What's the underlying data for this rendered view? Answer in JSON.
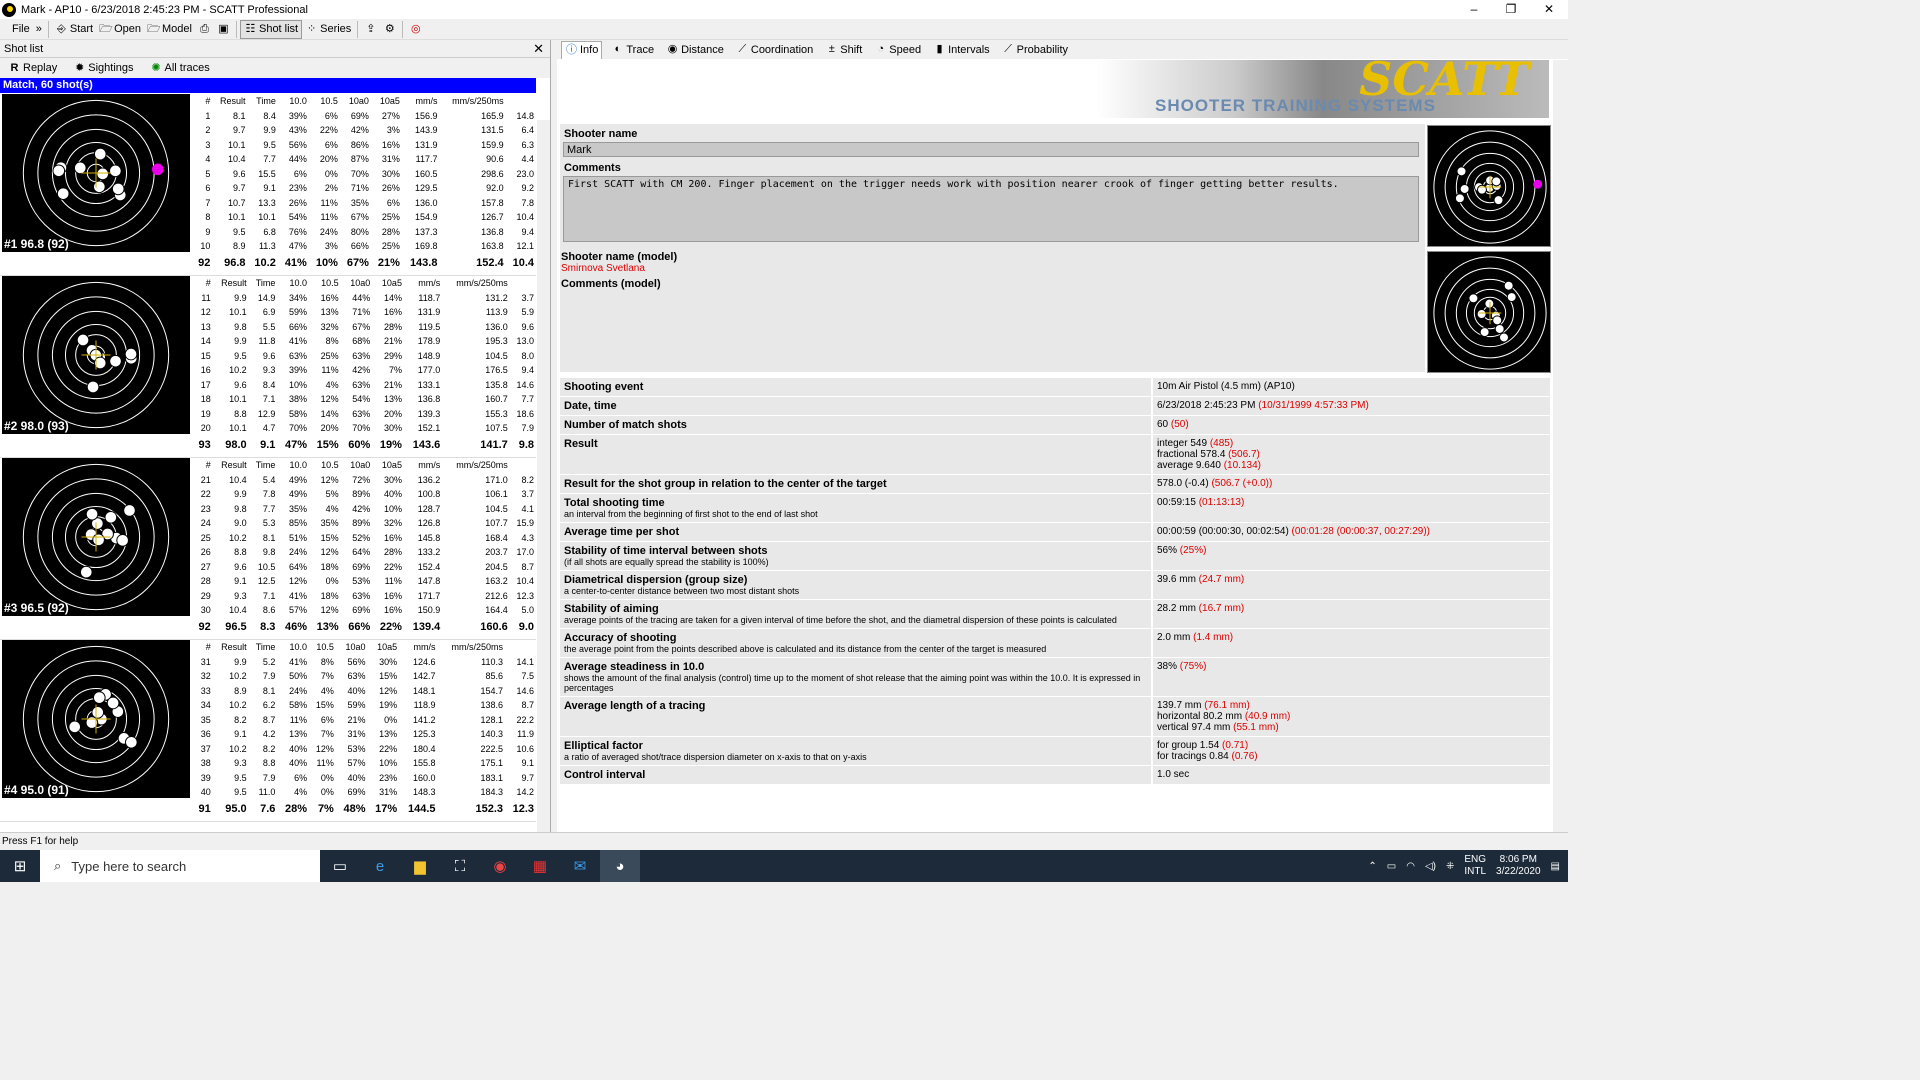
{
  "window": {
    "title": "Mark - AP10 - 6/23/2018 2:45:23 PM - SCATT Professional",
    "minimize": "–",
    "maximize": "❐",
    "close": "✕"
  },
  "menu": {
    "file": "File",
    "more": "»",
    "start": "Start",
    "open": "Open",
    "model": "Model",
    "shotlist": "Shot list",
    "series": "Series"
  },
  "left": {
    "header": "Shot list",
    "close": "✕",
    "replay": "Replay",
    "sightings": "Sightings",
    "alltraces": "All traces",
    "match": "Match, 60 shot(s)",
    "columns": [
      "#",
      "Result",
      "Time",
      "10.0",
      "10.5",
      "10a0",
      "10a5",
      "mm/s",
      "mm/s/250ms",
      ""
    ],
    "series": [
      {
        "label": "#1 96.8 (92)",
        "rows": [
          [
            "1",
            "8.1",
            "8.4",
            "39%",
            "6%",
            "69%",
            "27%",
            "156.9",
            "165.9",
            "14.8"
          ],
          [
            "2",
            "9.7",
            "9.9",
            "43%",
            "22%",
            "42%",
            "3%",
            "143.9",
            "131.5",
            "6.4"
          ],
          [
            "3",
            "10.1",
            "9.5",
            "56%",
            "6%",
            "86%",
            "16%",
            "131.9",
            "159.9",
            "6.3"
          ],
          [
            "4",
            "10.4",
            "7.7",
            "44%",
            "20%",
            "87%",
            "31%",
            "117.7",
            "90.6",
            "4.4"
          ],
          [
            "5",
            "9.6",
            "15.5",
            "6%",
            "0%",
            "70%",
            "30%",
            "160.5",
            "298.6",
            "23.0"
          ],
          [
            "6",
            "9.7",
            "9.1",
            "23%",
            "2%",
            "71%",
            "26%",
            "129.5",
            "92.0",
            "9.2"
          ],
          [
            "7",
            "10.7",
            "13.3",
            "26%",
            "11%",
            "35%",
            "6%",
            "136.0",
            "157.8",
            "7.8"
          ],
          [
            "8",
            "10.1",
            "10.1",
            "54%",
            "11%",
            "67%",
            "25%",
            "154.9",
            "126.7",
            "10.4"
          ],
          [
            "9",
            "9.5",
            "6.8",
            "76%",
            "24%",
            "80%",
            "28%",
            "137.3",
            "136.8",
            "9.4"
          ],
          [
            "10",
            "8.9",
            "11.3",
            "47%",
            "3%",
            "66%",
            "25%",
            "169.8",
            "163.8",
            "12.1"
          ]
        ],
        "sum": [
          "92",
          "96.8",
          "10.2",
          "41%",
          "10%",
          "67%",
          "21%",
          "143.8",
          "152.4",
          "10.4"
        ]
      },
      {
        "label": "#2 98.0 (93)",
        "rows": [
          [
            "11",
            "9.9",
            "14.9",
            "34%",
            "16%",
            "44%",
            "14%",
            "118.7",
            "131.2",
            "3.7"
          ],
          [
            "12",
            "10.1",
            "6.9",
            "59%",
            "13%",
            "71%",
            "16%",
            "131.9",
            "113.9",
            "5.9"
          ],
          [
            "13",
            "9.8",
            "5.5",
            "66%",
            "32%",
            "67%",
            "28%",
            "119.5",
            "136.0",
            "9.6"
          ],
          [
            "14",
            "9.9",
            "11.8",
            "41%",
            "8%",
            "68%",
            "21%",
            "178.9",
            "195.3",
            "13.0"
          ],
          [
            "15",
            "9.5",
            "9.6",
            "63%",
            "25%",
            "63%",
            "29%",
            "148.9",
            "104.5",
            "8.0"
          ],
          [
            "16",
            "10.2",
            "9.3",
            "39%",
            "11%",
            "42%",
            "7%",
            "177.0",
            "176.5",
            "9.4"
          ],
          [
            "17",
            "9.6",
            "8.4",
            "10%",
            "4%",
            "63%",
            "21%",
            "133.1",
            "135.8",
            "14.6"
          ],
          [
            "18",
            "10.1",
            "7.1",
            "38%",
            "12%",
            "54%",
            "13%",
            "136.8",
            "160.7",
            "7.7"
          ],
          [
            "19",
            "8.8",
            "12.9",
            "58%",
            "14%",
            "63%",
            "20%",
            "139.3",
            "155.3",
            "18.6"
          ],
          [
            "20",
            "10.1",
            "4.7",
            "70%",
            "20%",
            "70%",
            "30%",
            "152.1",
            "107.5",
            "7.9"
          ]
        ],
        "sum": [
          "93",
          "98.0",
          "9.1",
          "47%",
          "15%",
          "60%",
          "19%",
          "143.6",
          "141.7",
          "9.8"
        ]
      },
      {
        "label": "#3 96.5 (92)",
        "rows": [
          [
            "21",
            "10.4",
            "5.4",
            "49%",
            "12%",
            "72%",
            "30%",
            "136.2",
            "171.0",
            "8.2"
          ],
          [
            "22",
            "9.9",
            "7.8",
            "49%",
            "5%",
            "89%",
            "40%",
            "100.8",
            "106.1",
            "3.7"
          ],
          [
            "23",
            "9.8",
            "7.7",
            "35%",
            "4%",
            "42%",
            "10%",
            "128.7",
            "104.5",
            "4.1"
          ],
          [
            "24",
            "9.0",
            "5.3",
            "85%",
            "35%",
            "89%",
            "32%",
            "126.8",
            "107.7",
            "15.9"
          ],
          [
            "25",
            "10.2",
            "8.1",
            "51%",
            "15%",
            "52%",
            "16%",
            "145.8",
            "168.4",
            "4.3"
          ],
          [
            "26",
            "8.8",
            "9.8",
            "24%",
            "12%",
            "64%",
            "28%",
            "133.2",
            "203.7",
            "17.0"
          ],
          [
            "27",
            "9.6",
            "10.5",
            "64%",
            "18%",
            "69%",
            "22%",
            "152.4",
            "204.5",
            "8.7"
          ],
          [
            "28",
            "9.1",
            "12.5",
            "12%",
            "0%",
            "53%",
            "11%",
            "147.8",
            "163.2",
            "10.4"
          ],
          [
            "29",
            "9.3",
            "7.1",
            "41%",
            "18%",
            "63%",
            "16%",
            "171.7",
            "212.6",
            "12.3"
          ],
          [
            "30",
            "10.4",
            "8.6",
            "57%",
            "12%",
            "69%",
            "16%",
            "150.9",
            "164.4",
            "5.0"
          ]
        ],
        "sum": [
          "92",
          "96.5",
          "8.3",
          "46%",
          "13%",
          "66%",
          "22%",
          "139.4",
          "160.6",
          "9.0"
        ]
      },
      {
        "label": "#4 95.0 (91)",
        "rows": [
          [
            "31",
            "9.9",
            "5.2",
            "41%",
            "8%",
            "56%",
            "30%",
            "124.6",
            "110.3",
            "14.1"
          ],
          [
            "32",
            "10.2",
            "7.9",
            "50%",
            "7%",
            "63%",
            "15%",
            "142.7",
            "85.6",
            "7.5"
          ],
          [
            "33",
            "8.9",
            "8.1",
            "24%",
            "4%",
            "40%",
            "12%",
            "148.1",
            "154.7",
            "14.6"
          ],
          [
            "34",
            "10.2",
            "6.2",
            "58%",
            "15%",
            "59%",
            "19%",
            "118.9",
            "138.6",
            "8.7"
          ],
          [
            "35",
            "8.2",
            "8.7",
            "11%",
            "6%",
            "21%",
            "0%",
            "141.2",
            "128.1",
            "22.2"
          ],
          [
            "36",
            "9.1",
            "4.2",
            "13%",
            "7%",
            "31%",
            "13%",
            "125.3",
            "140.3",
            "11.9"
          ],
          [
            "37",
            "10.2",
            "8.2",
            "40%",
            "12%",
            "53%",
            "22%",
            "180.4",
            "222.5",
            "10.6"
          ],
          [
            "38",
            "9.3",
            "8.8",
            "40%",
            "11%",
            "57%",
            "10%",
            "155.8",
            "175.1",
            "9.1"
          ],
          [
            "39",
            "9.5",
            "7.9",
            "6%",
            "0%",
            "40%",
            "23%",
            "160.0",
            "183.1",
            "9.7"
          ],
          [
            "40",
            "9.5",
            "11.0",
            "4%",
            "0%",
            "69%",
            "31%",
            "148.3",
            "184.3",
            "14.2"
          ]
        ],
        "sum": [
          "91",
          "95.0",
          "7.6",
          "28%",
          "7%",
          "48%",
          "17%",
          "144.5",
          "152.3",
          "12.3"
        ]
      }
    ]
  },
  "right": {
    "tabs": [
      "Info",
      "Trace",
      "Distance",
      "Coordination",
      "Shift",
      "Speed",
      "Intervals",
      "Probability"
    ],
    "banner_big": "SCATT",
    "banner_small": "SHOOTER TRAINING SYSTEMS",
    "shooter_name_label": "Shooter name",
    "shooter_name": "Mark",
    "comments_label": "Comments",
    "comments": "First SCATT with CM 200. Finger placement on the trigger needs work with position nearer crook of finger getting better results.",
    "model_name_label": "Shooter name (model)",
    "model_name": "Smirnova Svetlana",
    "model_comments_label": "Comments (model)",
    "details": [
      {
        "k": "Shooting event",
        "s": "",
        "v": [
          "10m Air Pistol (4.5 mm) (AP10)"
        ],
        "r": [
          ""
        ]
      },
      {
        "k": "Date, time",
        "s": "",
        "v": [
          "6/23/2018 2:45:23 PM"
        ],
        "r": [
          " (10/31/1999 4:57:33 PM)"
        ]
      },
      {
        "k": "Number of match shots",
        "s": "",
        "v": [
          "60"
        ],
        "r": [
          " (50)"
        ]
      },
      {
        "k": "Result",
        "s": "",
        "v": [
          "integer 549",
          "fractional 578.4",
          "average 9.640"
        ],
        "r": [
          " (485)",
          " (506.7)",
          " (10.134)"
        ]
      },
      {
        "k": "Result for the shot group in relation to the center of the target",
        "s": "",
        "v": [
          "578.0 (-0.4)"
        ],
        "r": [
          " (506.7 (+0.0))"
        ]
      },
      {
        "k": "Total shooting time",
        "s": "an interval from the beginning of first shot to the end of last shot",
        "v": [
          "00:59:15"
        ],
        "r": [
          " (01:13:13)"
        ]
      },
      {
        "k": "Average time per shot",
        "s": "",
        "v": [
          "00:00:59 (00:00:30, 00:02:54)"
        ],
        "r": [
          " (00:01:28 (00:00:37, 00:27:29))"
        ]
      },
      {
        "k": "Stability of time interval between shots",
        "s": "(if all shots are equally spread the stability is 100%)",
        "v": [
          "56%"
        ],
        "r": [
          " (25%)"
        ]
      },
      {
        "k": "Diametrical dispersion (group size)",
        "s": "a center-to-center distance between two most distant shots",
        "v": [
          "39.6 mm"
        ],
        "r": [
          " (24.7 mm)"
        ]
      },
      {
        "k": "Stability of aiming",
        "s": "average points of the tracing are taken for a given interval of time before the shot, and the diametral dispersion of these points is calculated",
        "v": [
          "28.2 mm"
        ],
        "r": [
          " (16.7 mm)"
        ]
      },
      {
        "k": "Accuracy of shooting",
        "s": "the average point from the points described above is calculated and its distance from the center of the target is measured",
        "v": [
          "2.0 mm"
        ],
        "r": [
          " (1.4 mm)"
        ]
      },
      {
        "k": "Average steadiness in 10.0",
        "s": "shows the amount of the final analysis (control) time up to the moment of shot release that the aiming point was within the 10.0. It is expressed in percentages",
        "v": [
          "38%"
        ],
        "r": [
          " (75%)"
        ]
      },
      {
        "k": "Average length of a tracing",
        "s": "",
        "v": [
          "139.7 mm",
          "horizontal 80.2 mm",
          "vertical 97.4 mm"
        ],
        "r": [
          " (76.1 mm)",
          " (40.9 mm)",
          " (55.1 mm)"
        ]
      },
      {
        "k": "Elliptical factor",
        "s": "a ratio of averaged shot/trace dispersion diameter on x-axis to that on y-axis",
        "v": [
          "for group 1.54",
          "for tracings 0.84"
        ],
        "r": [
          " (0.71)",
          " (0.76)"
        ]
      },
      {
        "k": "Control interval",
        "s": "",
        "v": [
          "1.0 sec"
        ],
        "r": [
          ""
        ]
      }
    ]
  },
  "status": "Press F1 for help",
  "taskbar": {
    "search": "Type here to search",
    "lang1": "ENG",
    "lang2": "INTL",
    "time": "8:06 PM",
    "date": "3/22/2020"
  }
}
